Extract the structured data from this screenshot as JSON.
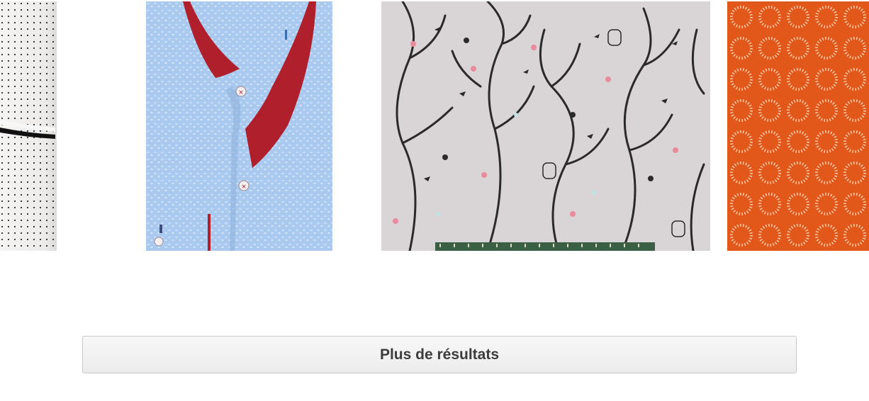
{
  "results": {
    "items": [
      {
        "description": "",
        "subject": "white-dotted-fabric"
      },
      {
        "description": "",
        "subject": "blue-shirt-red-collar"
      },
      {
        "description": "",
        "subject": "grey-branches-birds-fabric"
      },
      {
        "description": "",
        "subject": "orange-sun-circles-fabric"
      }
    ]
  },
  "more_results": {
    "label": "Plus de résultats"
  },
  "colors": {
    "button_bg": "#f0f0f0",
    "button_border": "#c8c8c8",
    "button_text": "#3c3c3c",
    "shirt_blue": "#a9c9ee",
    "collar_red": "#b0202c",
    "fabric_grey": "#d9d5d6",
    "orange": "#e2581a"
  }
}
